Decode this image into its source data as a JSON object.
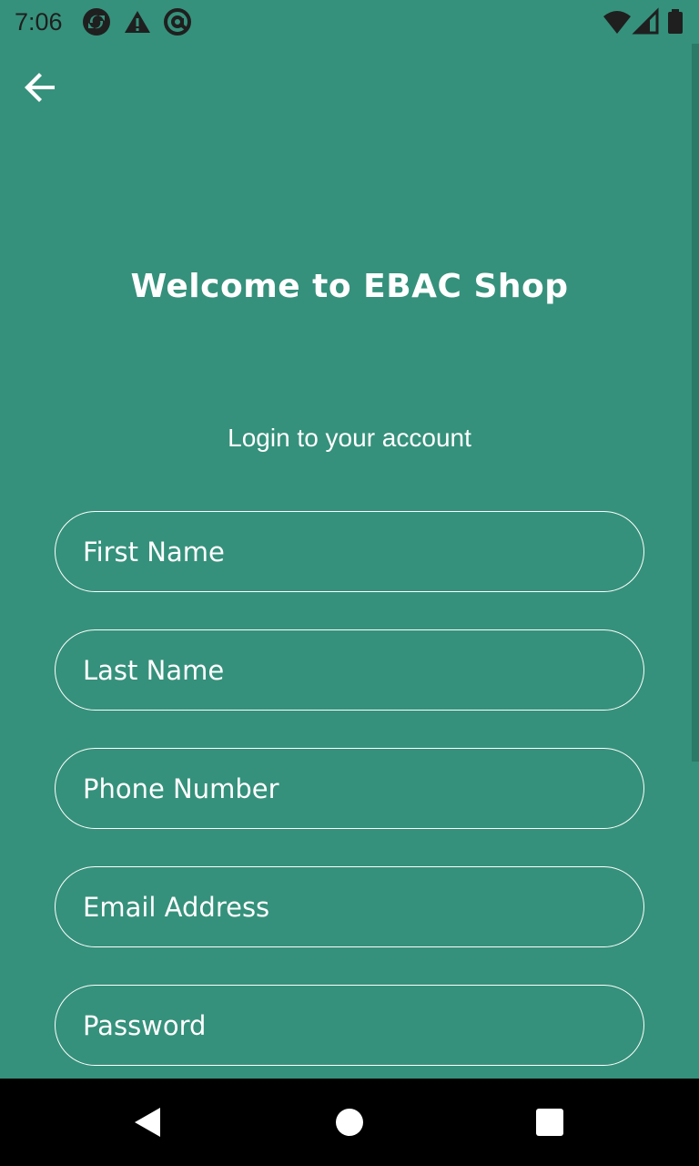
{
  "status_bar": {
    "time": "7:06",
    "icons": [
      "sync-app-icon",
      "warning-icon",
      "at-sign-icon",
      "wifi-icon",
      "signal-icon",
      "battery-icon"
    ]
  },
  "header": {
    "back_icon": "arrow-left-icon"
  },
  "main": {
    "title": "Welcome to EBAC Shop",
    "subtitle": "Login to your account",
    "fields": [
      {
        "name": "first-name",
        "placeholder": "First Name",
        "value": ""
      },
      {
        "name": "last-name",
        "placeholder": "Last Name",
        "value": ""
      },
      {
        "name": "phone-number",
        "placeholder": "Phone Number",
        "value": ""
      },
      {
        "name": "email-address",
        "placeholder": "Email Address",
        "value": ""
      },
      {
        "name": "password",
        "placeholder": "Password",
        "value": ""
      }
    ]
  },
  "nav_bar": {
    "icons": [
      "back-triangle-icon",
      "home-circle-icon",
      "recents-square-icon"
    ]
  },
  "colors": {
    "background": "#35917b",
    "text": "#ffffff",
    "status_text": "#1f1f1f",
    "nav_bar": "#000000"
  }
}
